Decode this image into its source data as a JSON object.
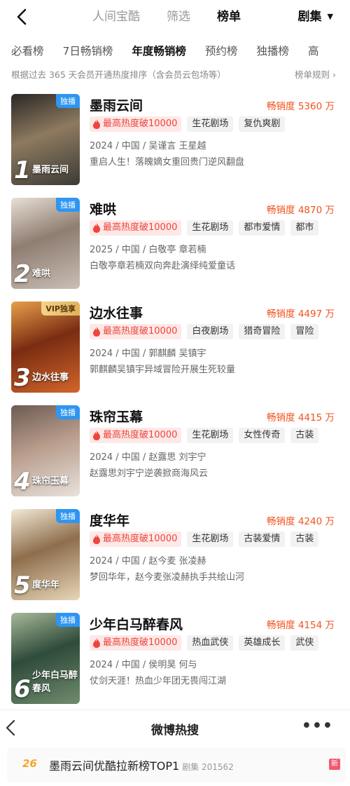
{
  "topnav": {
    "tabs": [
      "人间宝酷",
      "筛选",
      "榜单"
    ],
    "active_tab": 2,
    "genre_label": "剧集"
  },
  "subtabs": [
    "必看榜",
    "7日畅销榜",
    "年度畅销榜",
    "预约榜",
    "独播榜",
    "高"
  ],
  "active_subtab": 2,
  "info_text": "根据过去 365 天会员开通热度排序（含会员云包场等）",
  "rules_label": "榜单规则 ›",
  "colors": {
    "accent": "#f2511b",
    "heat": "#f0433c",
    "badge_blue": "#2e95f2"
  },
  "items": [
    {
      "rank": "1",
      "badge": "独播",
      "badge_type": "blue",
      "title": "墨雨云间",
      "poster_title": "墨雨云间",
      "sales": "畅销度 5360 万",
      "heat": "最高热度破10000",
      "tags": [
        "生花剧场",
        "复仇爽剧"
      ],
      "meta": "2024 / 中国 / 吴谨言 王星越",
      "desc": "重启人生！落魄嫡女重回贵门逆风翻盘",
      "poster_colors": [
        "#3d3a36",
        "#8d7a5f",
        "#2a2725"
      ]
    },
    {
      "rank": "2",
      "badge": "独播",
      "badge_type": "blue",
      "title": "难哄",
      "poster_title": "难哄",
      "sales": "畅销度 4870 万",
      "heat": "最高热度破10000",
      "tags": [
        "生花剧场",
        "都市爱情",
        "都市"
      ],
      "meta": "2025 / 中国 / 白敬亭 章若楠",
      "desc": "白敬亭章若楠双向奔赴演绎纯爱童话",
      "poster_colors": [
        "#c9bfb6",
        "#8f7d71",
        "#e8dfd6"
      ]
    },
    {
      "rank": "3",
      "badge": "VIP独享",
      "badge_type": "vip",
      "title": "边水往事",
      "poster_title": "边水往事",
      "sales": "畅销度 4497 万",
      "heat": "最高热度破10000",
      "tags": [
        "白夜剧场",
        "猎奇冒险",
        "冒险"
      ],
      "meta": "2024 / 中国 / 郭麒麟 吴镇宇",
      "desc": "郭麒麟吴镇宇异域冒险开展生死较量",
      "poster_colors": [
        "#d3662a",
        "#7a2c12",
        "#e8a04a"
      ]
    },
    {
      "rank": "4",
      "badge": "独播",
      "badge_type": "blue",
      "title": "珠帘玉幕",
      "poster_title": "珠帘玉幕",
      "sales": "畅销度 4415 万",
      "heat": "最高热度破10000",
      "tags": [
        "生花剧场",
        "女性传奇",
        "古装"
      ],
      "meta": "2024 / 中国 / 赵露思 刘宇宁",
      "desc": "赵露思刘宇宁逆袭掀商海风云",
      "poster_colors": [
        "#e8e2dc",
        "#b89c8c",
        "#6c5a52"
      ]
    },
    {
      "rank": "5",
      "badge": "独播",
      "badge_type": "blue",
      "title": "度华年",
      "poster_title": "度华年",
      "sales": "畅销度 4240 万",
      "heat": "最高热度破10000",
      "tags": [
        "生花剧场",
        "古装爱情",
        "古装"
      ],
      "meta": "2024 / 中国 / 赵今麦 张凌赫",
      "desc": "梦回华年，赵今麦张凌赫执手共绘山河",
      "poster_colors": [
        "#e6d6b8",
        "#8e6e4c",
        "#f3ead8"
      ]
    },
    {
      "rank": "6",
      "badge": "独播",
      "badge_type": "blue",
      "title": "少年白马醉春风",
      "poster_title": "少年白马醉春风",
      "sales": "畅销度 4154 万",
      "heat": "最高热度破10000",
      "tags": [
        "热血武侠",
        "英雄成长",
        "武侠"
      ],
      "meta": "2024 / 中国 / 侯明昊 何与",
      "desc": "仗剑天涯！热血少年团无畏闯江湖",
      "poster_colors": [
        "#6f8c6e",
        "#2f4b3a",
        "#a7b99a"
      ]
    }
  ],
  "weibo": {
    "title": "微博热搜",
    "more": "•••",
    "rank": "26",
    "text": "墨雨云间优酷拉新榜TOP1",
    "category": "剧集 201562",
    "new_label": "新"
  }
}
